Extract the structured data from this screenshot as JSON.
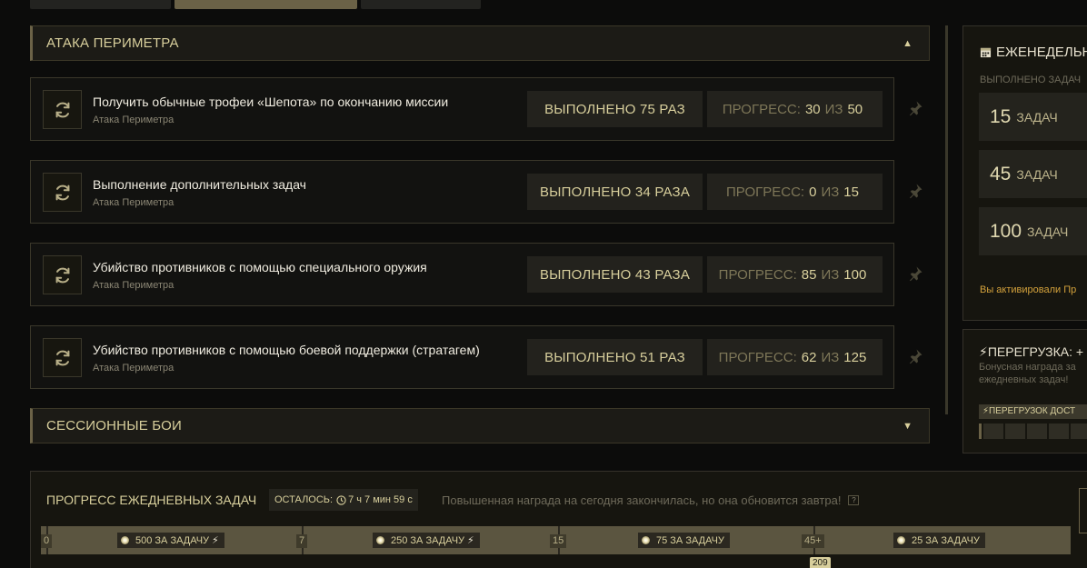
{
  "sections": {
    "perimeter": {
      "title": "АТАКА ПЕРИМЕТРА"
    },
    "session": {
      "title": "СЕССИОННЫЕ БОИ"
    }
  },
  "tasks": [
    {
      "name": "Получить обычные трофеи «Шепота» по окончанию миссии",
      "category": "Атака Периметра",
      "done": "ВЫПОЛНЕНО 75 РАЗ",
      "progress_label": "ПРОГРЕСС:",
      "current": "30",
      "of": "ИЗ",
      "total": "50"
    },
    {
      "name": "Выполнение дополнительных задач",
      "category": "Атака Периметра",
      "done": "ВЫПОЛНЕНО 34 РАЗА",
      "progress_label": "ПРОГРЕСС:",
      "current": "0",
      "of": "ИЗ",
      "total": "15"
    },
    {
      "name": "Убийство противников с помощью специального оружия",
      "category": "Атака Периметра",
      "done": "ВЫПОЛНЕНО 43 РАЗА",
      "progress_label": "ПРОГРЕСС:",
      "current": "85",
      "of": "ИЗ",
      "total": "100"
    },
    {
      "name": "Убийство противников с помощью боевой поддержки (стратагем)",
      "category": "Атака Периметра",
      "done": "ВЫПОЛНЕНО 51 РАЗ",
      "progress_label": "ПРОГРЕСС:",
      "current": "62",
      "of": "ИЗ",
      "total": "125"
    }
  ],
  "weekly": {
    "title": "ЕЖЕНЕДЕЛЬН",
    "subtitle": "ВЫПОЛНЕНО ЗАДАЧ",
    "tiers": [
      {
        "count": "15",
        "unit": "ЗАДАЧ"
      },
      {
        "count": "45",
        "unit": "ЗАДАЧ"
      },
      {
        "count": "100",
        "unit": "ЗАДАЧ"
      }
    ],
    "note": "Вы активировали Пр"
  },
  "overload": {
    "title": "ПЕРЕГРУЗКА: +",
    "desc_line1": "Бонусная награда за",
    "desc_line2": "ежедневных задач!",
    "bar_label": "ПЕРЕГРУЗОК ДОСТ"
  },
  "daily": {
    "title": "ПРОГРЕСС ЕЖЕДНЕВНЫХ ЗАДАЧ",
    "remaining_label": "ОСТАЛОСЬ:",
    "remaining_time": "7 ч 7 мин 59 с",
    "note": "Повышенная награда на сегодня закончилась, но она обновится завтра!",
    "help": "?",
    "ticks": [
      "0",
      "7",
      "15",
      "45+"
    ],
    "rewards": [
      {
        "label": "500 ЗА ЗАДАЧУ",
        "bolt": "⚡"
      },
      {
        "label": "250 ЗА ЗАДАЧУ",
        "bolt": "⚡"
      },
      {
        "label": "75 ЗА ЗАДАЧУ",
        "bolt": ""
      },
      {
        "label": "25 ЗА ЗАДАЧУ",
        "bolt": ""
      }
    ],
    "score": "209"
  },
  "colors": {
    "accent": "#d8cf9c",
    "warning": "#d4a23c",
    "panel": "#16150f"
  }
}
